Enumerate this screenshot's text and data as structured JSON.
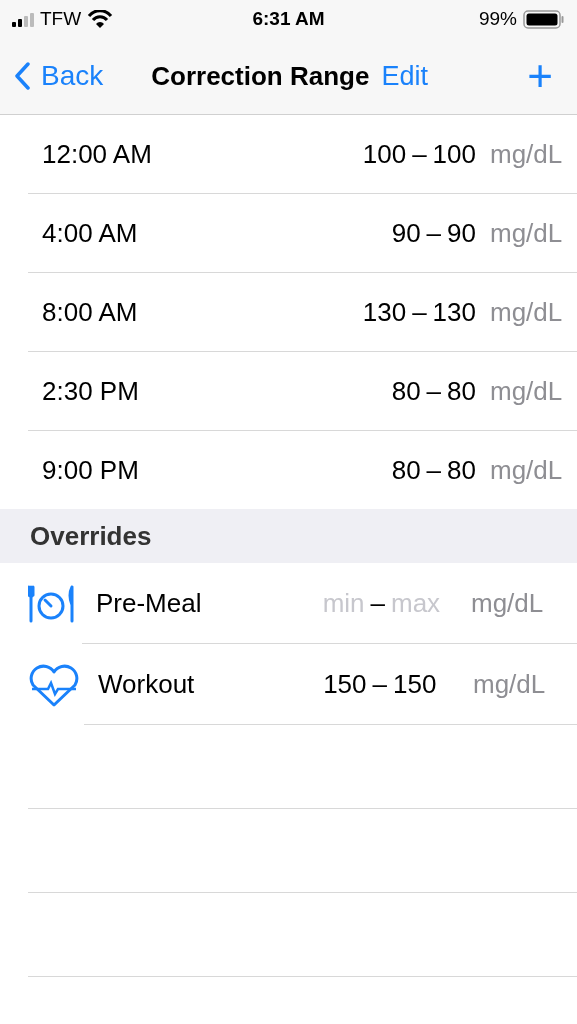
{
  "status_bar": {
    "carrier": "TFW",
    "time": "6:31 AM",
    "battery": "99%"
  },
  "nav": {
    "back": "Back",
    "title": "Correction Range",
    "edit": "Edit",
    "add": "+"
  },
  "schedule": [
    {
      "time": "12:00 AM",
      "min": "100",
      "separator": "–",
      "max": "100",
      "unit": "mg/dL"
    },
    {
      "time": "4:00 AM",
      "min": "90",
      "separator": "–",
      "max": "90",
      "unit": "mg/dL"
    },
    {
      "time": "8:00 AM",
      "min": "130",
      "separator": "–",
      "max": "130",
      "unit": "mg/dL"
    },
    {
      "time": "2:30 PM",
      "min": "80",
      "separator": "–",
      "max": "80",
      "unit": "mg/dL"
    },
    {
      "time": "9:00 PM",
      "min": "80",
      "separator": "–",
      "max": "80",
      "unit": "mg/dL"
    }
  ],
  "overrides_header": "Overrides",
  "overrides": [
    {
      "kind": "meal",
      "label": "Pre-Meal",
      "min": {
        "placeholder": "min"
      },
      "separator": "–",
      "max": {
        "placeholder": "max"
      },
      "unit": "mg/dL"
    },
    {
      "kind": "workout",
      "label": "Workout",
      "min": {
        "value": "150"
      },
      "separator": "–",
      "max": {
        "value": "150"
      },
      "unit": "mg/dL"
    }
  ]
}
